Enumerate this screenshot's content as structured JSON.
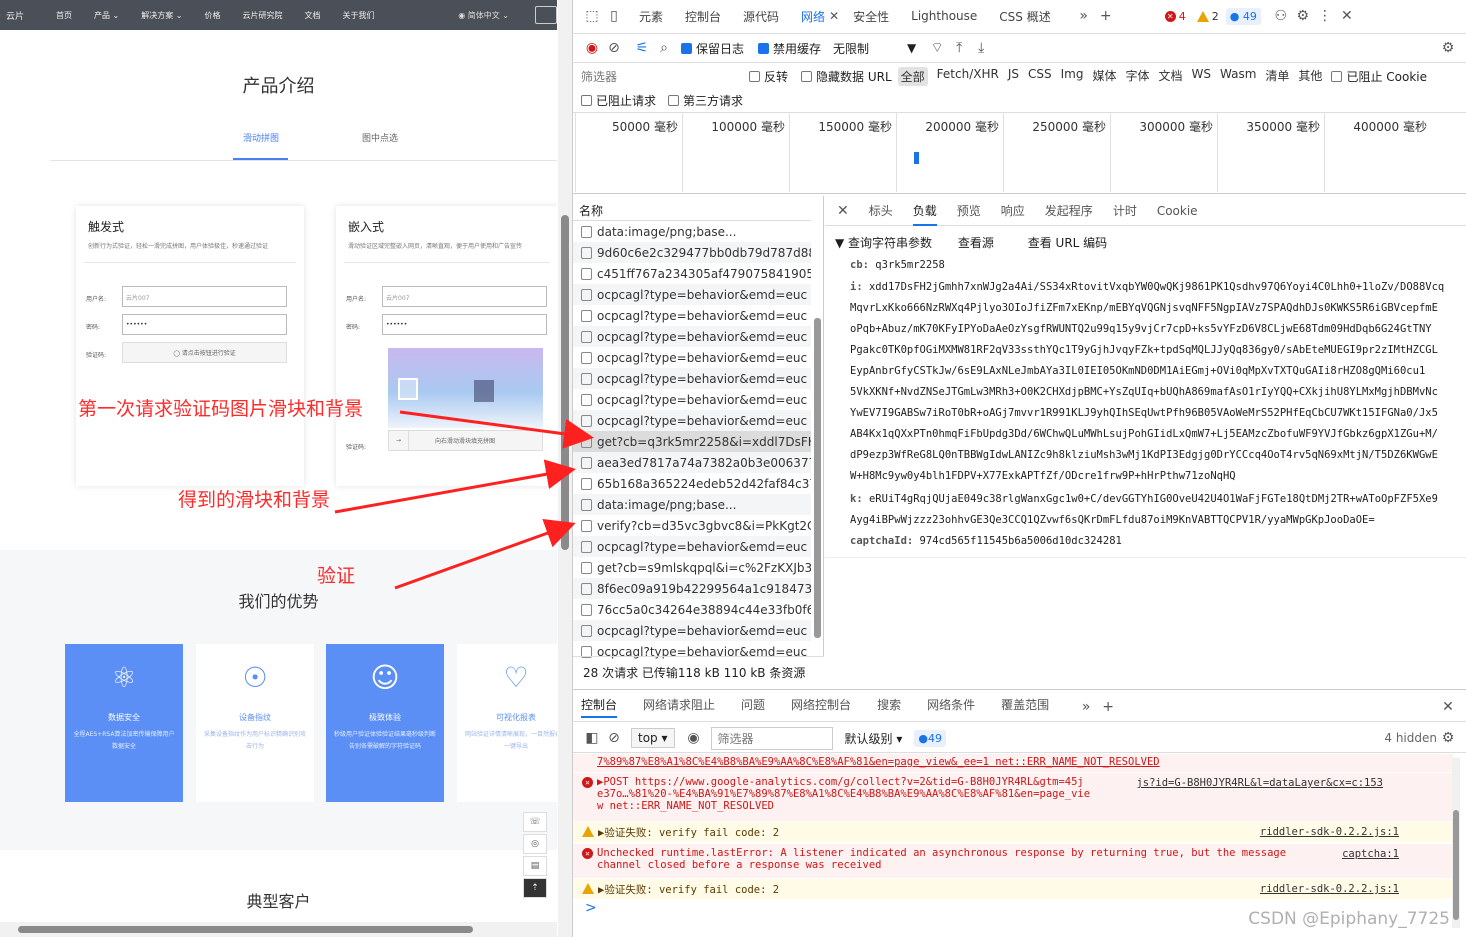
{
  "site": {
    "nav": {
      "logo": "云片",
      "items": [
        "首页",
        "产品 ⌄",
        "解决方案 ⌄",
        "价格",
        "云片研究院",
        "文档",
        "关于我们"
      ],
      "lang": "◉ 简体中文 ⌄"
    },
    "product_title": "产品介绍",
    "tabs": [
      "滑动拼图",
      "图中点选"
    ],
    "card1": {
      "title": "触发式",
      "desc": "创新行为式验证，轻松一滑完成拼图，用户体验极佳，秒速通过验证",
      "user_label": "用户名:",
      "user_ph": "云片007",
      "pass_label": "密码:",
      "pass_val": "••••••",
      "verify_label": "验证码:",
      "verify_btn": "◯ 请点击按钮进行验证"
    },
    "card2": {
      "title": "嵌入式",
      "desc": "滑动验证区域完整嵌入网页，清晰直观，便于用户使用和广告宣传",
      "user_label": "用户名:",
      "user_ph": "云片007",
      "pass_label": "密码:",
      "pass_val": "••••••",
      "verify_label": "验证码:",
      "slide_tip": "向右滑动滑块填充拼图"
    },
    "advantages_title": "我们的优势",
    "advantages": [
      {
        "icon": "⚛",
        "title": "数据安全",
        "desc": "全程AES+RSA算法加密传输保障用户数据安全",
        "style": "blue"
      },
      {
        "icon": "☉",
        "title": "设备指纹",
        "desc": "采集设备指纹作为用户标识精确识别攻击行为",
        "style": "white"
      },
      {
        "icon": "☺",
        "title": "极致体验",
        "desc": "秒级用户验证体验验证结果毫秒级判断告别各需破解的字符验证码",
        "style": "blue"
      },
      {
        "icon": "♡",
        "title": "可视化报表",
        "desc": "网站验证详情清晰展现，一目然报表可一键导出",
        "style": "white"
      }
    ],
    "customers_title": "典型客户",
    "float_buttons": [
      "☏",
      "◎",
      "▤",
      "⇡"
    ]
  },
  "annotations": {
    "first": "第一次请求验证码图片滑块和背景",
    "second": "得到的滑块和背景",
    "third": "验证"
  },
  "devtools": {
    "tabs": [
      "元素",
      "控制台",
      "源代码",
      "网络",
      "安全性",
      "Lighthouse",
      "CSS 概述"
    ],
    "badges": {
      "errors": "4",
      "warnings": "2",
      "info": "49"
    },
    "toolbar": {
      "preserve_log": "保留日志",
      "disable_cache": "禁用缓存",
      "throttle": "无限制"
    },
    "filter": {
      "placeholder": "筛选器",
      "invert": "反转",
      "hide_data": "隐藏数据 URL",
      "types": [
        "全部",
        "Fetch/XHR",
        "JS",
        "CSS",
        "Img",
        "媒体",
        "字体",
        "文档",
        "WS",
        "Wasm",
        "清单",
        "其他"
      ],
      "blocked_cookie": "已阻止 Cookie",
      "blocked_req": "已阻止请求",
      "third_party": "第三方请求"
    },
    "timeline": [
      "50000 毫秒",
      "100000 毫秒",
      "150000 毫秒",
      "200000 毫秒",
      "250000 毫秒",
      "300000 毫秒",
      "350000 毫秒",
      "400000 毫秒"
    ],
    "list_header": "名称",
    "requests": [
      "data:image/png;base...",
      "9d60c6e2c329477bb0db79d787d889...",
      "c451ff767a234305af4790758419051e...",
      "ocpcagl?type=behavior&emd=euc",
      "ocpcagl?type=behavior&emd=euc",
      "ocpcagl?type=behavior&emd=euc",
      "ocpcagl?type=behavior&emd=euc",
      "ocpcagl?type=behavior&emd=euc",
      "ocpcagl?type=behavior&emd=euc",
      "ocpcagl?type=behavior&emd=euc",
      "get?cb=q3rk5mr2258&i=xddl7DsFH2...",
      "aea3ed7817a74a7382a0b3e0063774...",
      "65b168a365224edeb52d42faf84c37c...",
      "data:image/png;base...",
      "verify?cb=d35vc3gbvc8&i=PkKgt2CL...",
      "ocpcagl?type=behavior&emd=euc",
      "get?cb=s9mlskqpql&i=c%2FzKXJb3X...",
      "8f6ec09a919b42299564a1c91847384...",
      "76cc5a0c34264e38894c44e33fb0f646...",
      "ocpcagl?type=behavior&emd=euc",
      "ocpcagl?type=behavior&emd=euc"
    ],
    "summary": "28 次请求  已传输118 kB  110 kB 条资源",
    "detail_tabs": [
      "标头",
      "负载",
      "预览",
      "响应",
      "发起程序",
      "计时",
      "Cookie"
    ],
    "payload": {
      "section": "▼ 查询字符串参数",
      "view_source": "查看源",
      "view_url": "查看 URL 编码",
      "cb_key": "cb:",
      "cb_val": "q3rk5mr2258",
      "i_key": "i:",
      "i_lines": [
        "xdd17DsFH2jGmhh7xnWJg2a4Ai/SS34xRtovitVxqbYW0QwQKj9861PK1Qsdhv97Q6Yoyi4C0Lhh0+1loZv/DO88Vcq",
        "MqvrLxKko666NzRWXq4Pjlyo3OIoJfiZFm7xEKnp/mEBYqVQGNjsvqNFF5NgpIAVz7SPAQdhDJs0KWKS5R6iGBVcepfmE",
        "oPqb+Abuz/mK70KFyIPYoDaAeOzYsgfRWUNTQ2u99q15y9vjCr7cpD+ks5vYFzD6V8CLjwE68Tdm09HdDqb6G24GtTNY",
        "Pgakc0TK0pfOGiMXMW81RF2qV33ssthYQc1T9yGjhJvqyFZk+tpdSqMQLJJyQq836gy0/sAbEteMUEGI9pr2zIMtHZCGL",
        "EypAnbrGfyCSTkJw/6sE9LAxNLeJmbAYa3IL0IEI05OKmND0DM1AiEGmj+OVi0qMpXvTXTQuGAIi8rHZO8gQMi60cu1",
        "5VkXKNf+NvdZNSeJTGmLw3MRh3+O0K2CHXdjpBMC+YsZqUIq+bUQhA869mafAsO1rIyYQQ+CXkjihU8YLMxMgjhDBMvNc",
        "YwEV7I9GABSw7iRoT0bR+oAGj7mvvr1R991KLJ9yhQIhSEqUwtPfh96B05VAoWeMrS52PHfEqCbCU7WKt15IFGNa0/Jx5",
        "AB4Kx1qQXxPTn0hmqFiFbUpdg3Dd/6WChwQLuMWhLsujPohGIidLxQmW7+Lj5EAMzcZbofuWF9YVJfGbkz6gpX1ZGu+M/",
        "dP9ezp3WfReG8LQ0nTBBWgIdwLANIZc9h8klziuMsh3wMj1KdPI3Edgjg0DrYCCcq4OoT4rv5qN69xMtjN/T5DZ6KWGwE",
        "W+H8Mc9yw0y4blh1FDPV+X77ExkAPTfZf/ODcre1frw9P+hHrPthw71zoNqHQ"
      ],
      "k_key": "k:",
      "k_lines": [
        "eRUiT4gRqjQUjaE049c38rlgWanxGgc1w0+C/devGGTYhIG0OveU42U4O1WaFjFGTe18QtDMj2TR+wAToOpFZF5Xe9",
        "Ayg4iBPwWjzzz23ohhvGE3Qe3CCQ1QZvwf6sQKrDmFLfdu87oiM9KnVABTTQCPV1R/yyaMWpGKpJooDaOE="
      ],
      "captcha_key": "captchaId:",
      "captcha_val": "974cd565f11545b6a5006d10dc324281"
    },
    "drawer_tabs": [
      "控制台",
      "网络请求阻止",
      "问题",
      "网络控制台",
      "搜索",
      "网络条件",
      "覆盖范围"
    ],
    "console_toolbar": {
      "context": "top",
      "filter_ph": "筛选器",
      "level": "默认级别",
      "issues": "49",
      "hidden": "4 hidden"
    },
    "console": [
      {
        "type": "err-cont",
        "text": "7%89%87%E8%A1%8C%E4%B8%BA%E9%AA%8C%E8%AF%81&en=page_view&_ee=1 net::ERR_NAME_NOT_RESOLVED",
        "src": ""
      },
      {
        "type": "err",
        "text": "▶POST https://www.google-analytics.com/g/collect?v=2&tid=G-B8H0JYR4RL&gtm=45j",
        "text2": "e37o…%81%20-%E4%BA%91%E7%89%87%E8%A1%8C%E4%B8%BA%E9%AA%8C%E8%AF%81&en=page_vie",
        "text3": "w net::ERR_NAME_NOT_RESOLVED",
        "src": "js?id=G-B8H0JYR4RL&l=dataLayer&cx=c:153"
      },
      {
        "type": "warn",
        "text": "▶验证失败: verify fail code: 2",
        "src": "riddler-sdk-0.2.2.js:1"
      },
      {
        "type": "err",
        "text": "Unchecked runtime.lastError: A listener indicated an asynchronous response by returning true, but the message",
        "text2": "channel closed before a response was received",
        "src": "captcha:1"
      },
      {
        "type": "warn",
        "text": "▶验证失败: verify fail code: 2",
        "src": "riddler-sdk-0.2.2.js:1"
      }
    ],
    "prompt": ">",
    "watermark": "CSDN @Epiphany_7725"
  }
}
